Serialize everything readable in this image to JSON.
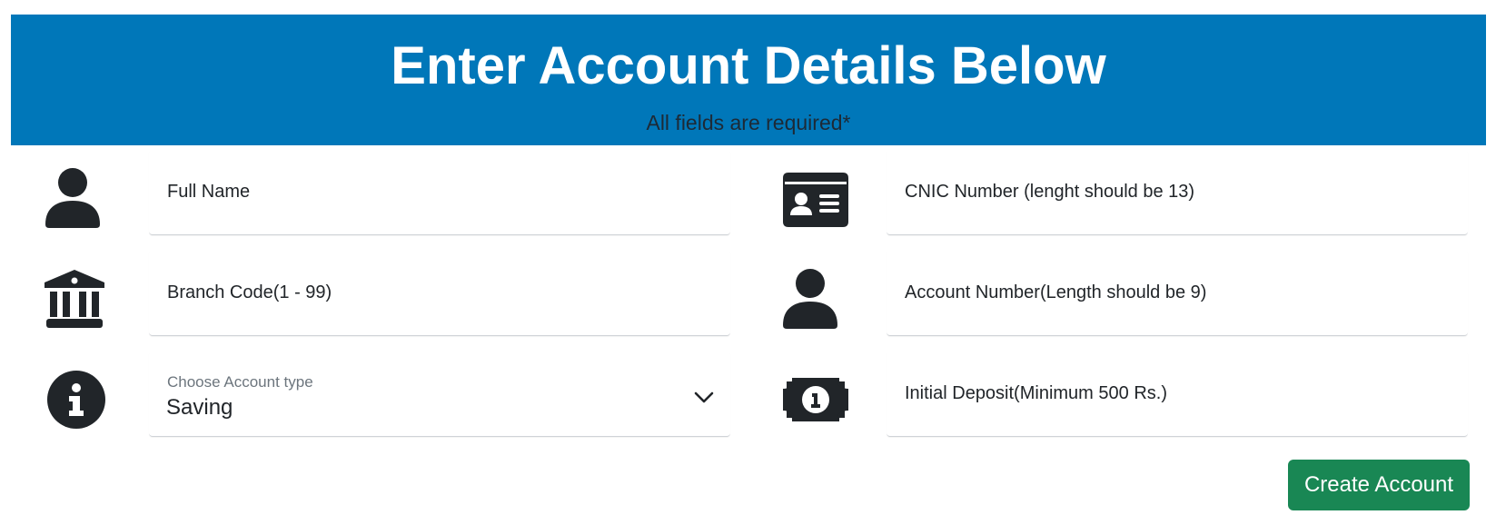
{
  "header": {
    "title": "Enter Account Details Below",
    "subtitle": "All fields are required*"
  },
  "fields": {
    "full_name": {
      "placeholder": "Full Name",
      "icon": "user-icon"
    },
    "cnic": {
      "placeholder": "CNIC Number (lenght should be 13)",
      "icon": "id-card-icon"
    },
    "branch_code": {
      "placeholder": "Branch Code(1 - 99)",
      "icon": "bank-building-icon"
    },
    "account_number": {
      "placeholder": "Account Number(Length should be 9)",
      "icon": "user-icon"
    },
    "account_type": {
      "label": "Choose Account type",
      "selected": "Saving",
      "icon": "info-circle-icon"
    },
    "initial_deposit": {
      "placeholder": "Initial Deposit(Minimum 500 Rs.)",
      "icon": "money-bill-icon"
    }
  },
  "actions": {
    "create_label": "Create Account"
  },
  "colors": {
    "header_bg": "#0077b9",
    "button_bg": "#198754",
    "icon_color": "#212529"
  }
}
